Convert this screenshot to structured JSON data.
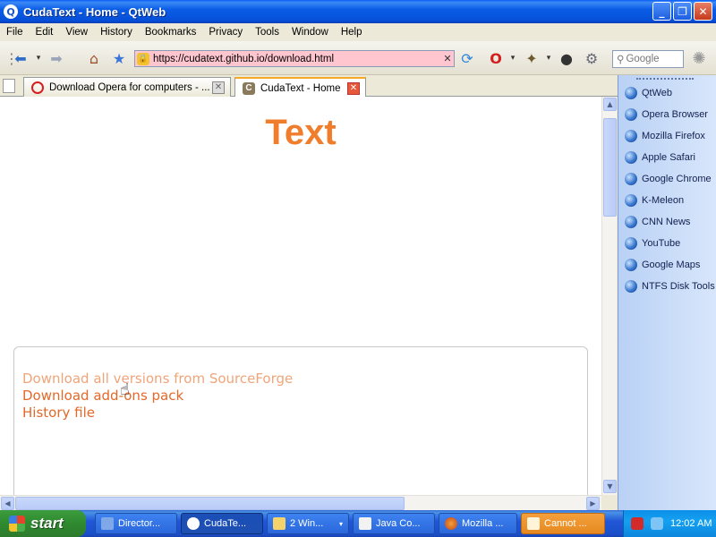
{
  "window": {
    "title": "CudaText - Home - QtWeb"
  },
  "menu": [
    "File",
    "Edit",
    "View",
    "History",
    "Bookmarks",
    "Privacy",
    "Tools",
    "Window",
    "Help"
  ],
  "toolbar": {
    "url": "https://cudatext.github.io/download.html",
    "search_placeholder": "Google"
  },
  "tabs": [
    {
      "label": "Download Opera for computers - ...",
      "active": false
    },
    {
      "label": "CudaText - Home",
      "active": true
    }
  ],
  "page": {
    "heading": "Text",
    "links": [
      "Download all versions from SourceForge",
      "Download add-ons pack",
      "History file"
    ]
  },
  "sidebar": {
    "items": [
      "QtWeb",
      "Opera Browser",
      "Mozilla Firefox",
      "Apple Safari",
      "Google Chrome",
      "K-Meleon",
      "CNN News",
      "YouTube",
      "Google Maps",
      "NTFS Disk Tools"
    ]
  },
  "taskbar": {
    "start_label": "start",
    "tasks": [
      {
        "label": "Director..."
      },
      {
        "label": "CudaTe..."
      },
      {
        "label": "2 Win..."
      },
      {
        "label": "Java Co..."
      },
      {
        "label": "Mozilla ..."
      },
      {
        "label": "Cannot ..."
      }
    ],
    "clock": "12:02 AM"
  },
  "colors": {
    "accent": "#f07d2c",
    "link": "#e3682a",
    "link_visited": "#efa57a"
  }
}
